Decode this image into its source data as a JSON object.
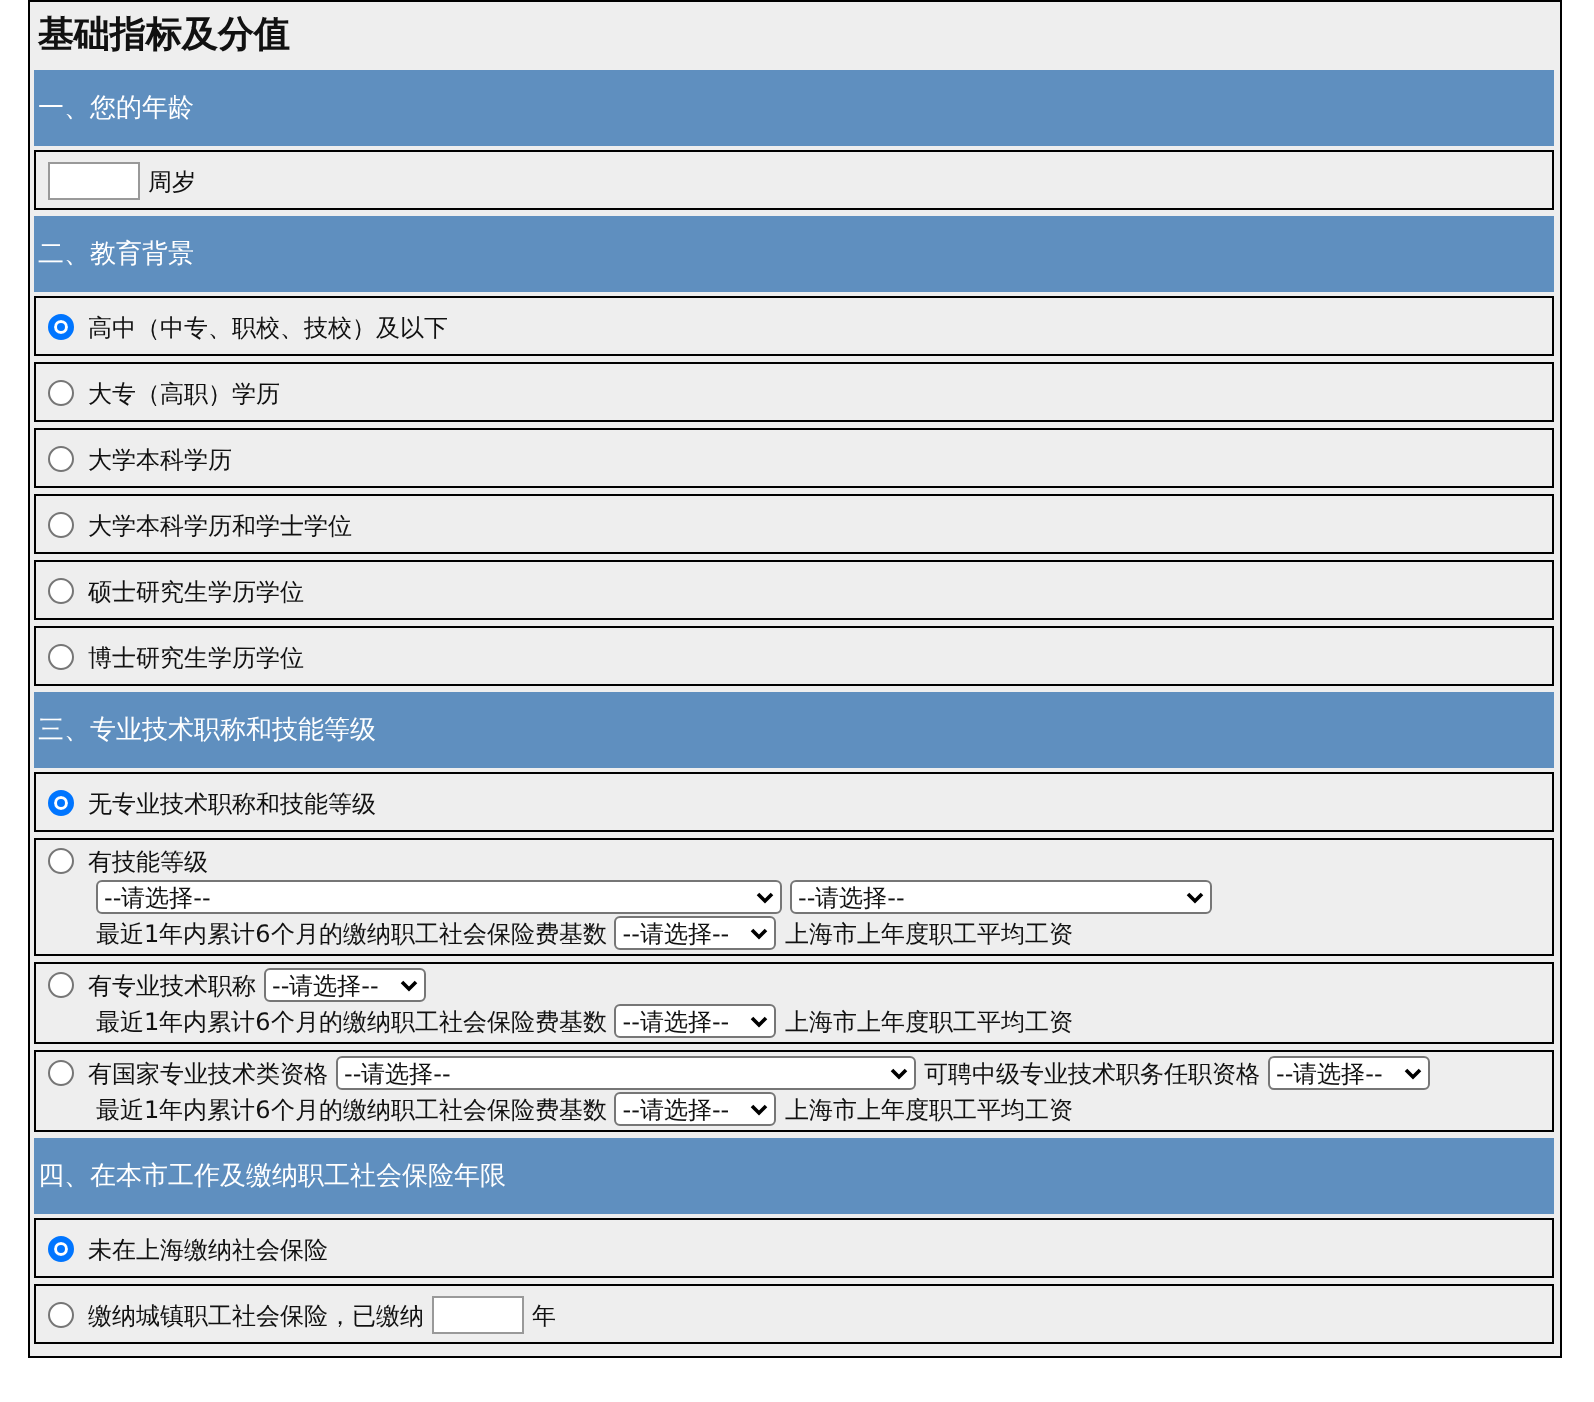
{
  "title": "基础指标及分值",
  "sections": [
    {
      "heading": "一、您的年龄",
      "items": [
        {
          "kind": "plain",
          "parts": [
            {
              "kind": "input"
            },
            {
              "kind": "text",
              "text": "周岁"
            }
          ]
        }
      ]
    },
    {
      "heading": "二、教育背景",
      "items": [
        {
          "kind": "radio",
          "label": "高中（中专、职校、技校）及以下",
          "selected": true
        },
        {
          "kind": "radio",
          "label": "大专（高职）学历",
          "selected": false
        },
        {
          "kind": "radio",
          "label": "大学本科学历",
          "selected": false
        },
        {
          "kind": "radio",
          "label": "大学本科学历和学士学位",
          "selected": false
        },
        {
          "kind": "radio",
          "label": "硕士研究生学历学位",
          "selected": false
        },
        {
          "kind": "radio",
          "label": "博士研究生学历学位",
          "selected": false
        }
      ]
    },
    {
      "heading": "三、专业技术职称和技能等级",
      "items": [
        {
          "kind": "radio",
          "label": "无专业技术职称和技能等级",
          "selected": true
        },
        {
          "kind": "radio",
          "label": "有技能等级",
          "selected": false,
          "lines": [
            [
              {
                "kind": "long_select",
                "value": "--请选择--"
              },
              {
                "kind": "medium_select",
                "value": "--请选择--"
              }
            ],
            [
              {
                "kind": "text",
                "text": "最近1年内累计6个月的缴纳职工社会保险费基数"
              },
              {
                "kind": "select",
                "value": "--请选择--"
              },
              {
                "kind": "text",
                "text": "上海市上年度职工平均工资"
              }
            ]
          ]
        },
        {
          "kind": "radio",
          "label": "有专业技术职称",
          "selected": false,
          "parts": [
            {
              "kind": "select",
              "value": "--请选择--"
            }
          ],
          "lines": [
            [
              {
                "kind": "text",
                "text": "最近1年内累计6个月的缴纳职工社会保险费基数"
              },
              {
                "kind": "select",
                "value": "--请选择--"
              },
              {
                "kind": "text",
                "text": "上海市上年度职工平均工资"
              }
            ]
          ]
        },
        {
          "kind": "radio",
          "label": "有国家专业技术类资格",
          "selected": false,
          "parts": [
            {
              "kind": "wide_select",
              "value": "--请选择--"
            },
            {
              "kind": "text",
              "text": "可聘中级专业技术职务任职资格"
            },
            {
              "kind": "select",
              "value": "--请选择--"
            }
          ],
          "lines": [
            [
              {
                "kind": "text",
                "text": "最近1年内累计6个月的缴纳职工社会保险费基数"
              },
              {
                "kind": "select",
                "value": "--请选择--"
              },
              {
                "kind": "text",
                "text": "上海市上年度职工平均工资"
              }
            ]
          ]
        }
      ]
    },
    {
      "heading": "四、在本市工作及缴纳职工社会保险年限",
      "items": [
        {
          "kind": "radio",
          "label": "未在上海缴纳社会保险",
          "selected": true
        },
        {
          "kind": "radio",
          "label": "缴纳城镇职工社会保险，已缴纳",
          "selected": false,
          "parts": [
            {
              "kind": "input"
            },
            {
              "kind": "text",
              "text": "年"
            }
          ]
        }
      ]
    }
  ]
}
